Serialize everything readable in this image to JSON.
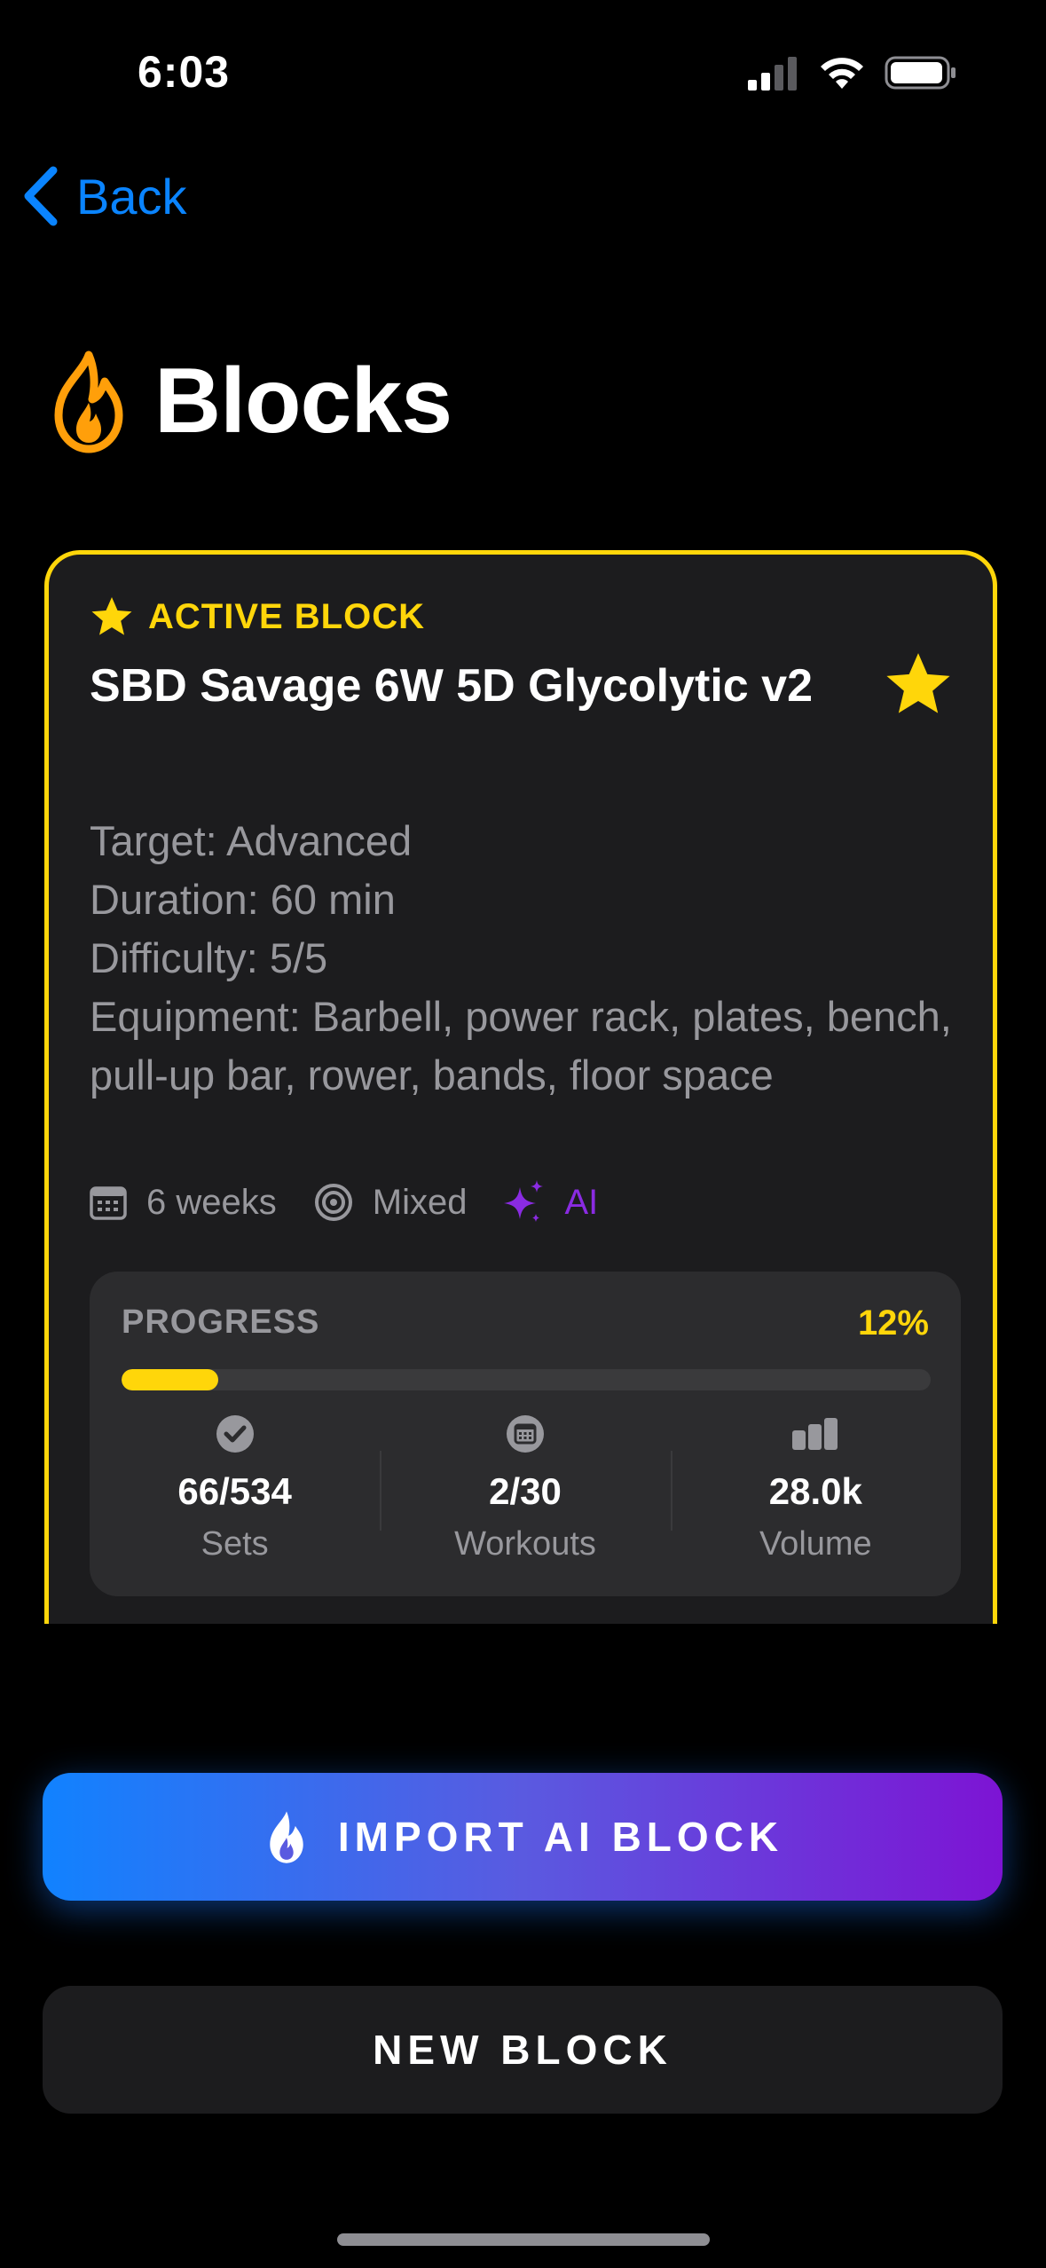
{
  "status_bar": {
    "time": "6:03"
  },
  "nav": {
    "back_label": "Back"
  },
  "page": {
    "title": "Blocks",
    "title_icon": "flame-icon"
  },
  "active_block": {
    "badge": "ACTIVE BLOCK",
    "title": "SBD Savage 6W 5D Glycolytic v2",
    "details": {
      "target": "Target: Advanced",
      "duration": "Duration: 60 min",
      "difficulty": "Difficulty: 5/5",
      "equipment": "Equipment: Barbell, power rack, plates, bench, pull-up bar, rower, bands, floor space"
    },
    "meta": {
      "weeks": "6 weeks",
      "type": "Mixed",
      "source": "AI"
    },
    "progress": {
      "label": "PROGRESS",
      "percent_text": "12%",
      "percent": 0.12,
      "stats": [
        {
          "icon": "checkmark-circle-icon",
          "value": "66/534",
          "label": "Sets"
        },
        {
          "icon": "calendar-icon",
          "value": "2/30",
          "label": "Workouts"
        },
        {
          "icon": "bar-chart-icon",
          "value": "28.0k",
          "label": "Volume"
        }
      ]
    }
  },
  "buttons": {
    "import_label": "IMPORT AI BLOCK",
    "new_label": "NEW BLOCK"
  },
  "colors": {
    "accent_yellow": "#ffd60a",
    "link_blue": "#0a84ff",
    "ai_purple": "#8a2be2",
    "card_bg": "#1c1c1e"
  }
}
